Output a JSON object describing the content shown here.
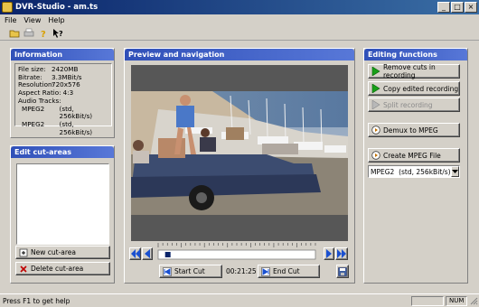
{
  "window": {
    "title": "DVR-Studio - am.ts"
  },
  "menu": {
    "file": "File",
    "view": "View",
    "help": "Help"
  },
  "info": {
    "heading": "Information",
    "rows": [
      {
        "k": "File size:",
        "v": "2420MB"
      },
      {
        "k": "Bitrate:",
        "v": "3.3MBit/s"
      },
      {
        "k": "Resolution:",
        "v": "720x576"
      },
      {
        "k": "Aspect Ratio:",
        "v": "4:3"
      }
    ],
    "audio_label": "Audio Tracks:",
    "tracks": [
      {
        "k": "MPEG2",
        "v": "(std, 256kBit/s)"
      },
      {
        "k": "MPEG2",
        "v": "(std, 256kBit/s)"
      }
    ]
  },
  "cut": {
    "heading": "Edit cut-areas",
    "new_label": "New cut-area",
    "delete_label": "Delete cut-area"
  },
  "preview": {
    "heading": "Preview and navigation",
    "start_cut": "Start Cut",
    "end_cut": "End Cut",
    "timecode": "00:21:25",
    "position_fraction": 0.05
  },
  "editing": {
    "heading": "Editing functions",
    "remove_cuts": "Remove cuts in recording",
    "copy_edited": "Copy edited recording",
    "split": "Split recording",
    "demux": "Demux to MPEG",
    "create_mpeg": "Create MPEG File",
    "format_value": "MPEG2  (std, 256kBit/s)"
  },
  "status": {
    "text": "Press F1 to get help",
    "num": "NUM"
  },
  "colors": {
    "title_start": "#0a246a",
    "title_end": "#3a6ea5",
    "panel_head": "#3050b8",
    "nav_arrow": "#1a50d0",
    "go_green": "#18a018"
  }
}
